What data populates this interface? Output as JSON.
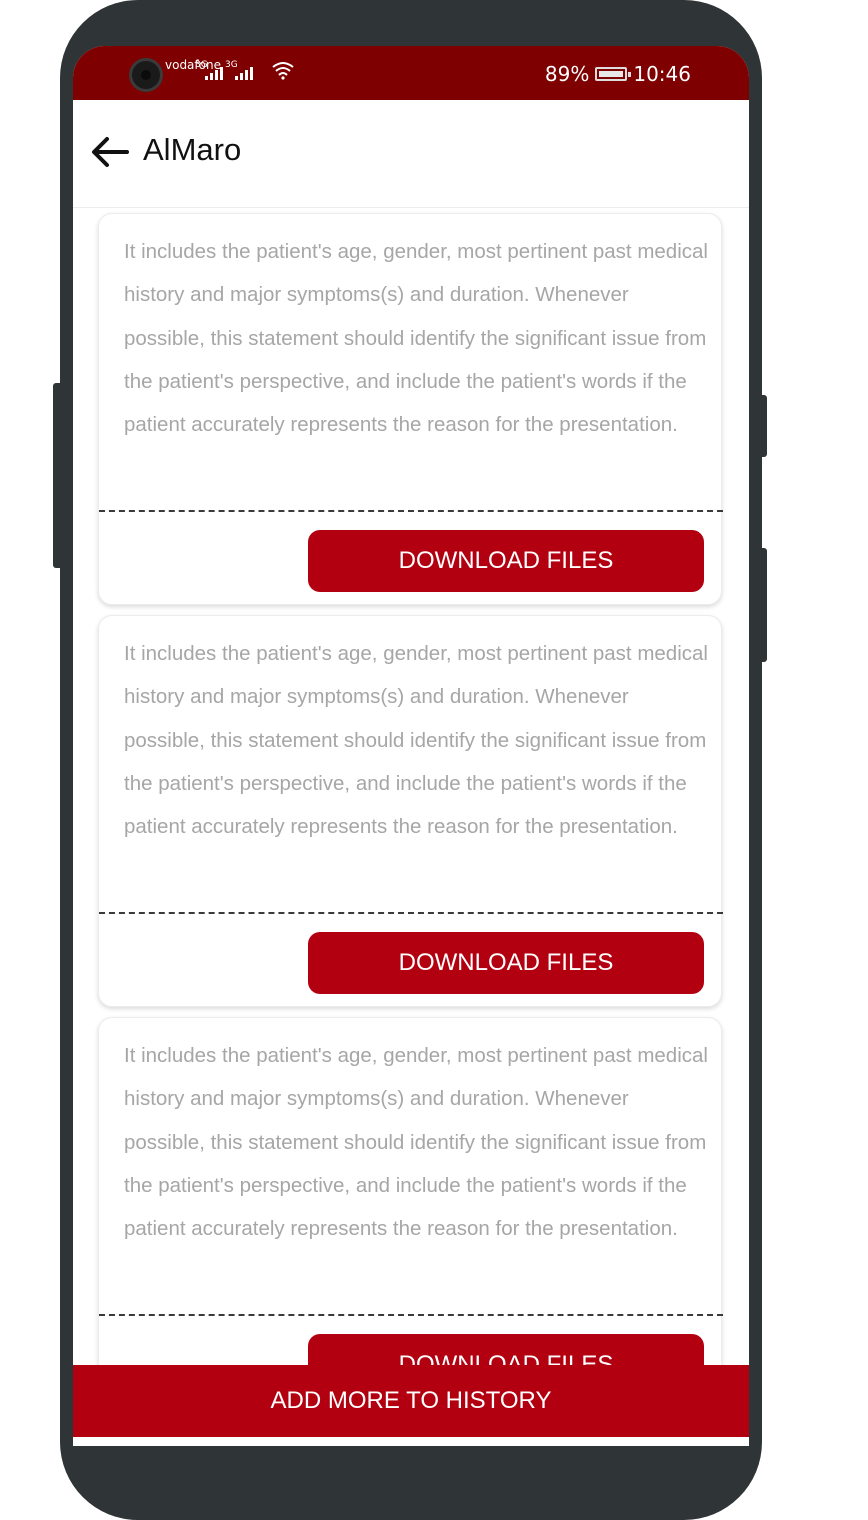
{
  "status_bar": {
    "carrier": "vodafone",
    "signal_1_label": "3G",
    "signal_2_label": "3G",
    "battery": "89%",
    "time": "10:46"
  },
  "app_bar": {
    "title": "AlMaro"
  },
  "history": {
    "items": [
      {
        "text": "It includes the patient's age, gender, most pertinent past medical history and major symptoms(s) and duration. Whenever possible, this statement should identify the significant issue from the patient's perspective, and include the patient's words if the patient accurately represents the reason for the presentation.",
        "button_label": "DOWNLOAD FILES"
      },
      {
        "text": "It includes the patient's age, gender, most pertinent past medical history and major symptoms(s) and duration. Whenever possible, this statement should identify the significant issue from the patient's perspective, and include the patient's words if the patient accurately represents the reason for the presentation.",
        "button_label": "DOWNLOAD FILES"
      },
      {
        "text": "It includes the patient's age, gender, most pertinent past medical history and major symptoms(s) and duration. Whenever possible, this statement should identify the significant issue from the patient's perspective, and include the patient's words if the patient accurately represents the reason for the presentation.",
        "button_label": "DOWNLOAD FILES"
      }
    ]
  },
  "bottom_bar": {
    "label": "ADD MORE TO HISTORY"
  },
  "colors": {
    "status_bar": "#7e0000",
    "accent": "#b30010",
    "body_text": "#a6a6a6"
  }
}
